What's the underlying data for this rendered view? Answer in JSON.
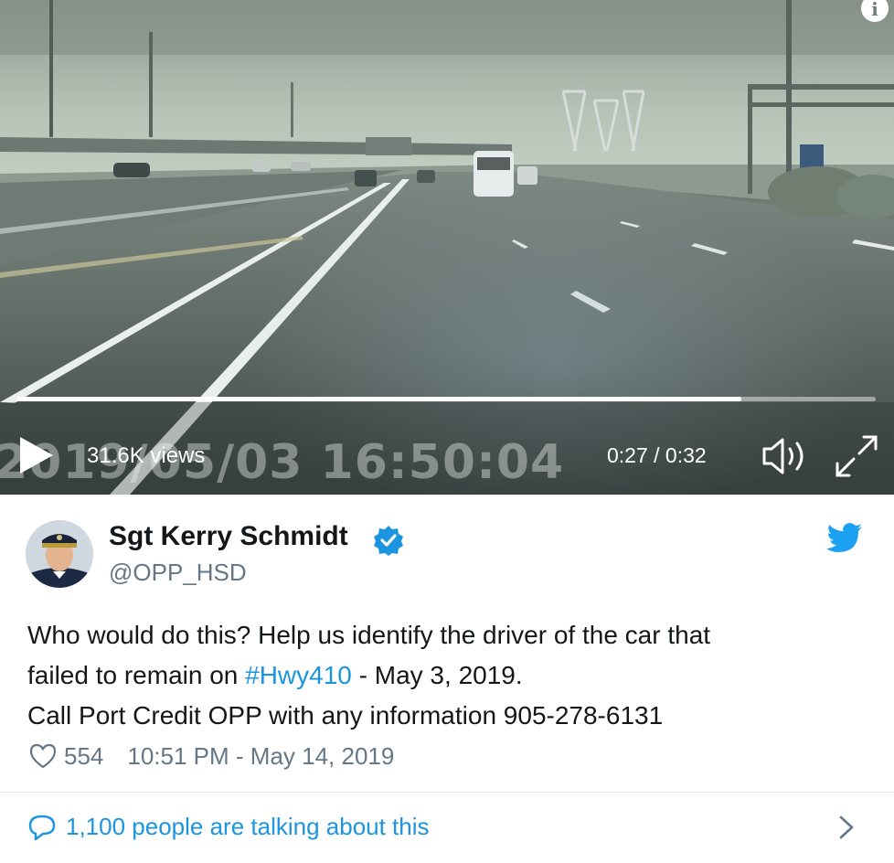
{
  "video": {
    "timestamp_overlay": "2019/05/03  16:50:04",
    "views": "31.6K views",
    "time": "0:27 / 0:32",
    "progress": 0.844,
    "icons": [
      "info-icon",
      "play-icon",
      "volume-icon",
      "fullscreen-icon"
    ]
  },
  "tweet": {
    "author_name": "Sgt Kerry Schmidt",
    "handle": "@OPP_HSD",
    "text_line1": "Who would do this? Help us identify the driver of the car that",
    "text_line2_before": "failed to remain on ",
    "hashtag": "#Hwy410",
    "text_line2_after": " - May 3, 2019.",
    "text_line3": "Call Port Credit OPP with any information 905-278-6131",
    "like_count": "554",
    "timestamp": "10:51 PM - May 14, 2019",
    "talking_about": "1,100 people are talking about this",
    "icons": [
      "avatar",
      "verified-icon",
      "twitter-bird-icon",
      "heart-icon",
      "speech-bubble-icon",
      "chevron-right-icon"
    ]
  },
  "colors": {
    "link_blue": "#1b95e0",
    "text_primary": "#14171a",
    "text_secondary": "#657786"
  }
}
